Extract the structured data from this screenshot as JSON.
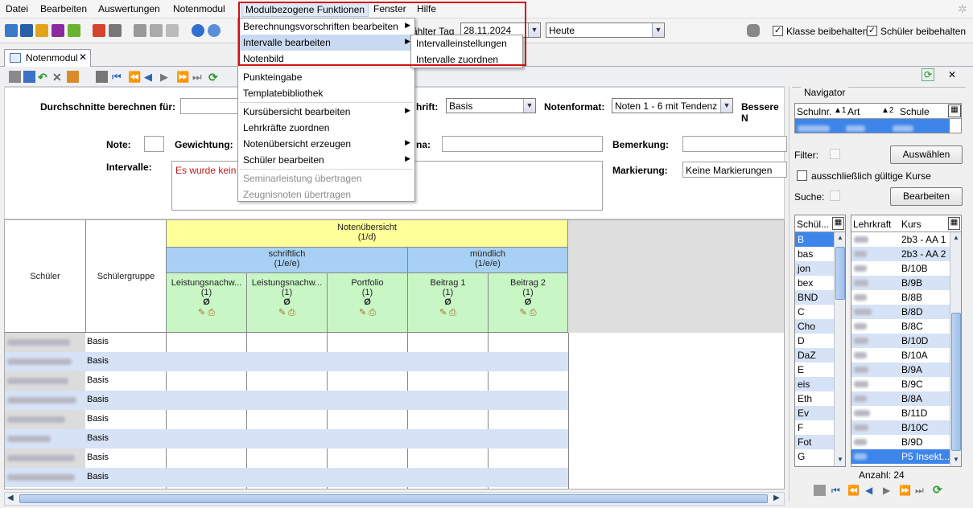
{
  "menubar": {
    "items": [
      "Datei",
      "Bearbeiten",
      "Auswertungen",
      "Notenmodul",
      "Modulbezogene Funktionen",
      "Fenster",
      "Hilfe"
    ]
  },
  "toolbar": {
    "date_label": "ählter Tag",
    "date_value": "28.11.2024",
    "date_shortcut": "Heute",
    "keep_class": "Klasse beibehalten",
    "keep_student": "Schüler beibehalten"
  },
  "tab": {
    "label": "Notenmodul",
    "close": "✕"
  },
  "menu_main": {
    "items": [
      {
        "label": "Berechnungsvorschriften bearbeiten",
        "sub": true,
        "disabled": false
      },
      {
        "label": "Intervalle bearbeiten",
        "sub": true,
        "disabled": false,
        "highlighted": true
      },
      {
        "label": "Notenbild",
        "sub": false,
        "disabled": false
      },
      {
        "label": "Punkteingabe",
        "sub": false,
        "disabled": false
      },
      {
        "label": "Templatebibliothek",
        "sub": false,
        "disabled": false
      },
      {
        "label": "Kursübersicht bearbeiten",
        "sub": true,
        "disabled": false
      },
      {
        "label": "Lehrkräfte zuordnen",
        "sub": false,
        "disabled": false
      },
      {
        "label": "Notenübersicht erzeugen",
        "sub": true,
        "disabled": false
      },
      {
        "label": "Schüler bearbeiten",
        "sub": true,
        "disabled": false
      },
      {
        "label": "Seminarleistung übertragen",
        "sub": false,
        "disabled": true
      },
      {
        "label": "Zeugnisnoten übertragen",
        "sub": false,
        "disabled": true
      }
    ]
  },
  "menu_sub": {
    "items": [
      "Intervalleinstellungen",
      "Intervalle zuordnen"
    ]
  },
  "filters": {
    "averages_label": "Durchschnitte berechnen für:",
    "schrift_label": "hrift:",
    "schrift_value": "Basis",
    "notenformat_label": "Notenformat:",
    "notenformat_value": "Noten 1 - 6 mit Tendenz",
    "bessere_label": "Bessere N",
    "note_label": "Note:",
    "gewichtung_label": "Gewichtung:",
    "na_label": "na:",
    "bemerkung_label": "Bemerkung:",
    "intervalle_label": "Intervalle:",
    "intervalle_text": "Es wurde kein I",
    "markierung_label": "Markierung:",
    "markierung_value": "Keine Markierungen"
  },
  "grid": {
    "col_student": "Schüler",
    "col_group": "Schülergruppe",
    "overview_title": "Notenübersicht",
    "overview_sub": "(1/d)",
    "written_title": "schriftlich",
    "written_sub": "(1/e/e)",
    "oral_title": "mündlich",
    "oral_sub": "(1/e/e)",
    "columns": [
      {
        "name": "Leistungsnachw...",
        "weight": "(1)",
        "avg": "Ø"
      },
      {
        "name": "Leistungsnachw...",
        "weight": "(1)",
        "avg": "Ø"
      },
      {
        "name": "Portfolio",
        "weight": "(1)",
        "avg": "Ø"
      },
      {
        "name": "Beitrag 1",
        "weight": "(1)",
        "avg": "Ø"
      },
      {
        "name": "Beitrag 2",
        "weight": "(1)",
        "avg": "Ø"
      }
    ],
    "groups": [
      "Basis",
      "Basis",
      "Basis",
      "Basis",
      "Basis",
      "Basis",
      "Basis",
      "Basis"
    ]
  },
  "navigator": {
    "title": "Navigator",
    "col_schulnr": "Schulnr.",
    "col_schulnr_sort": "▲1",
    "col_art": "Art",
    "col_art_sort": "▲2",
    "col_schule": "Schule",
    "filter_label": "Filter:",
    "select_button": "Auswählen",
    "only_valid": "ausschließlich gültige Kurse",
    "search_label": "Suche:",
    "edit_button": "Bearbeiten",
    "col_schueler": "Schül...",
    "col_lehrkraft": "Lehrkraft",
    "col_kurs": "Kurs",
    "subjects": [
      "B",
      "bas",
      "jon",
      "bex",
      "BND",
      "C",
      "Cho",
      "D",
      "DaZ",
      "E",
      "eis",
      "Eth",
      "Ev",
      "F",
      "Fot",
      "G"
    ],
    "courses": [
      "2b3 - AA 1",
      "2b3 - AA 2",
      "B/10B",
      "B/9B",
      "B/8B",
      "B/8D",
      "B/8C",
      "B/10D",
      "B/10A",
      "B/9A",
      "B/9C",
      "B/8A",
      "B/11D",
      "B/10C",
      "B/9D",
      "P5 Insekt..."
    ],
    "count": "Anzahl: 24"
  },
  "colors": {
    "overview_bg": "#ffff99",
    "written_bg": "#a8d0f4",
    "column_bg": "#c8f7c5",
    "selection": "#3d85ea",
    "highlight_box": "#d01010"
  }
}
